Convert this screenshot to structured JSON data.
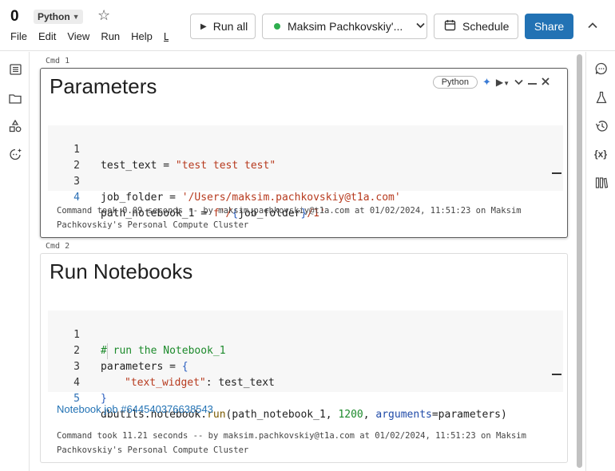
{
  "header": {
    "notebook_title": "0",
    "language": "Python",
    "menu": [
      "File",
      "Edit",
      "View",
      "Run",
      "Help",
      "L"
    ],
    "run_all_label": "Run all",
    "cluster_label": "Maksim Pachkovskiy'...",
    "cluster_status_color": "#2eae4e",
    "schedule_label": "Schedule",
    "share_label": "Share"
  },
  "left_rail": {
    "icons": [
      "table-of-contents-icon",
      "folder-icon",
      "shapes-icon",
      "assistant-icon"
    ]
  },
  "right_rail": {
    "icons": [
      "comments-icon",
      "experiments-icon",
      "history-icon",
      "variables-icon",
      "data-icon"
    ]
  },
  "cells": [
    {
      "cmd_label": "Cmd 1",
      "title": "Parameters",
      "language_pill": "Python",
      "code_lines": [
        {
          "n": "1",
          "text": "test_text = \"test test test\""
        },
        {
          "n": "2",
          "text": ""
        },
        {
          "n": "3",
          "text": "job_folder = '/Users/maksim.pachkovskiy@t1a.com'"
        },
        {
          "n": "4",
          "text": "path_notebook_1 = f'/{job_folder}/1'"
        }
      ],
      "output": "Command took 0.09 seconds -- by maksim.pachkovskiy@t1a.com at 01/02/2024, 11:51:23 on Maksim Pachkovskiy's Personal Compute Cluster"
    },
    {
      "cmd_label": "Cmd 2",
      "title": "Run Notebooks",
      "code_lines": [
        {
          "n": "1",
          "text": "# run the Notebook_1"
        },
        {
          "n": "2",
          "text": "parameters = {"
        },
        {
          "n": "3",
          "text": "\"text_widget\": test_text"
        },
        {
          "n": "4",
          "text": "}"
        },
        {
          "n": "5",
          "text": "dbutils.notebook.run(path_notebook_1, 1200, arguments=parameters)"
        }
      ],
      "job_link": "Notebook job #644540376638543",
      "output": "Command took 11.21 seconds -- by maksim.pachkovskiy@t1a.com at 01/02/2024, 11:51:23 on Maksim Pachkovskiy's Personal Compute Cluster"
    }
  ]
}
